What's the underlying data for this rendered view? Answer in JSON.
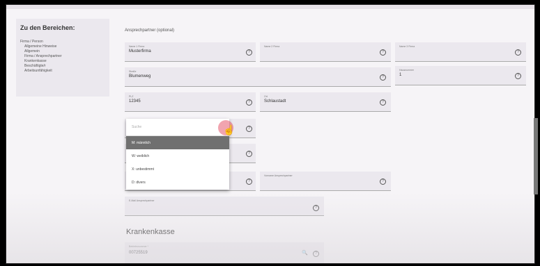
{
  "sidebar": {
    "title": "Zu den Bereichen:",
    "items": [
      {
        "label": "Firma / Person"
      },
      {
        "label": "Allgemeine Hinweise"
      },
      {
        "label": "Allgemein"
      },
      {
        "label": "Firma / Ansprechpartner"
      },
      {
        "label": "Krankenkasse"
      },
      {
        "label": "Beschäftigte/r"
      },
      {
        "label": "Arbeitsunfähigkeit"
      }
    ]
  },
  "section": {
    "ansprechpartner_label": "Ansprechpartner (optional)"
  },
  "fields": {
    "name1": {
      "label": "Name 1 Firma",
      "value": "Musterfirma"
    },
    "name2": {
      "label": "Name 2 Firma",
      "value": ""
    },
    "name3": {
      "label": "Name 3 Firma",
      "value": ""
    },
    "strasse": {
      "label": "Straße",
      "value": "Blumenweg"
    },
    "hausnummer": {
      "label": "Hausnummer",
      "value": "1"
    },
    "plz": {
      "label": "PLZ",
      "value": "12345"
    },
    "ort": {
      "label": "Ort",
      "value": "Schlaustadt"
    },
    "vorname": {
      "label": "Vorname Ansprechpartner",
      "value": ""
    },
    "email": {
      "label": "E-Mail Ansprechpartner",
      "value": ""
    },
    "betriebsnummer": {
      "label": "Betriebsnummer *",
      "value": "00725519"
    }
  },
  "dropdown": {
    "search_placeholder": "Suche",
    "options": [
      {
        "label": "M: männlich",
        "selected": true
      },
      {
        "label": "W: weiblich",
        "selected": false
      },
      {
        "label": "X: unbestimmt",
        "selected": false
      },
      {
        "label": "D: divers",
        "selected": false
      }
    ]
  },
  "krankenkasse": {
    "title": "Krankenkasse"
  },
  "icons": {
    "info": "info-icon",
    "search": "search-icon",
    "cursor": "hand-pointer-icon"
  },
  "colors": {
    "background": "#f6f4f7",
    "field": "#ebe8ee",
    "selected_option": "#707070"
  }
}
